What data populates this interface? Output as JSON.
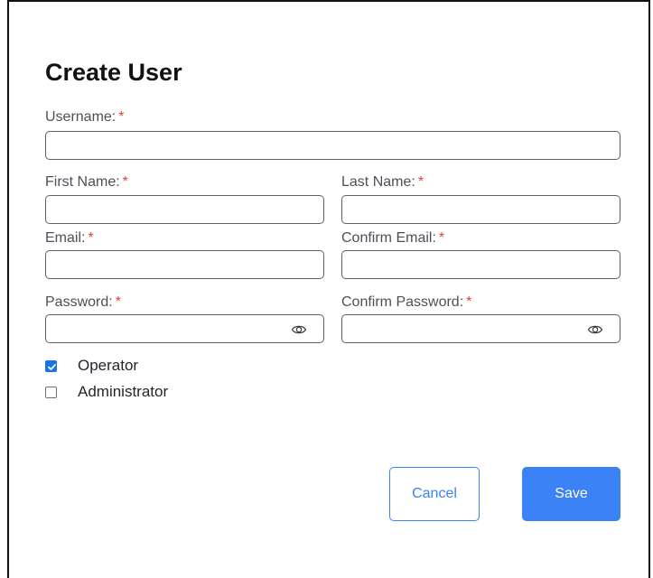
{
  "dialog": {
    "title": "Create User",
    "required_marker": "*"
  },
  "fields": {
    "username": {
      "label": "Username:",
      "value": "",
      "placeholder": ""
    },
    "first_name": {
      "label": "First Name:",
      "value": "",
      "placeholder": ""
    },
    "last_name": {
      "label": "Last Name:",
      "value": "",
      "placeholder": ""
    },
    "email": {
      "label": "Email:",
      "value": "",
      "placeholder": ""
    },
    "confirm_email": {
      "label": "Confirm Email:",
      "value": "",
      "placeholder": ""
    },
    "password": {
      "label": "Password:",
      "value": "",
      "placeholder": ""
    },
    "confirm_password": {
      "label": "Confirm Password:",
      "value": "",
      "placeholder": ""
    }
  },
  "roles": [
    {
      "label": "Operator",
      "checked": true
    },
    {
      "label": "Administrator",
      "checked": false
    }
  ],
  "actions": {
    "cancel_label": "Cancel",
    "save_label": "Save"
  },
  "icons": {
    "password_toggle": "eye-icon",
    "checkmark": "check-icon"
  },
  "colors": {
    "accent": "#3b82f6",
    "required": "#e0443c",
    "checkbox_checked": "#1a73e8"
  }
}
